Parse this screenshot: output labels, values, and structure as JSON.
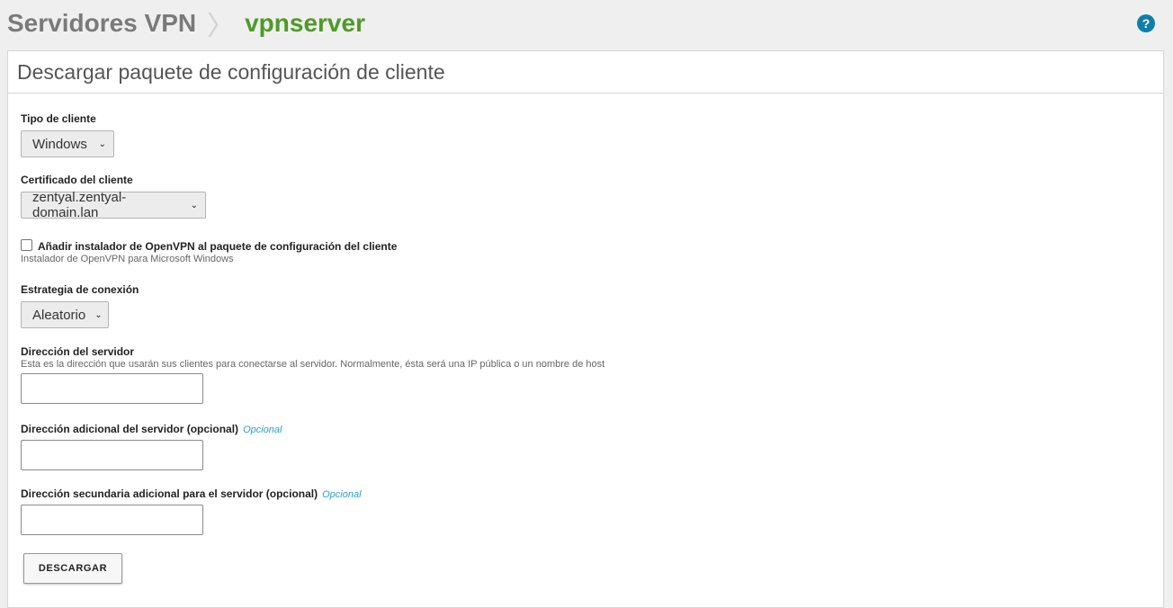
{
  "header": {
    "breadcrumb_parent": "Servidores VPN",
    "breadcrumb_separator": "〉",
    "breadcrumb_current": "vpnserver",
    "help_icon": "?"
  },
  "panel": {
    "title": "Descargar paquete de configuración de cliente"
  },
  "form": {
    "client_type": {
      "label": "Tipo de cliente",
      "value": "Windows"
    },
    "client_cert": {
      "label": "Certificado del cliente",
      "value": "zentyal.zentyal-domain.lan"
    },
    "installer": {
      "label": "Añadir instalador de OpenVPN al paquete de configuración del cliente",
      "help": "Instalador de OpenVPN para Microsoft Windows",
      "checked": false
    },
    "strategy": {
      "label": "Estrategia de conexión",
      "value": "Aleatorio"
    },
    "server_address": {
      "label": "Dirección del servidor",
      "help": "Esta es la dirección que usarán sus clientes para conectarse al servidor. Normalmente, ésta será una IP pública o un nombre de host",
      "value": ""
    },
    "additional_address": {
      "label": "Dirección adicional del servidor (opcional)",
      "optional": "Opcional",
      "value": ""
    },
    "secondary_address": {
      "label": "Dirección secundaria adicional para el servidor (opcional)",
      "optional": "Opcional",
      "value": ""
    },
    "download_button": "DESCARGAR"
  },
  "colors": {
    "accent_green": "#4e9a26",
    "help_blue": "#0e7fa8",
    "optional_blue": "#2aa0c8"
  },
  "icons": {
    "help": "question-circle-icon",
    "select_arrow": "chevron-down-icon"
  }
}
